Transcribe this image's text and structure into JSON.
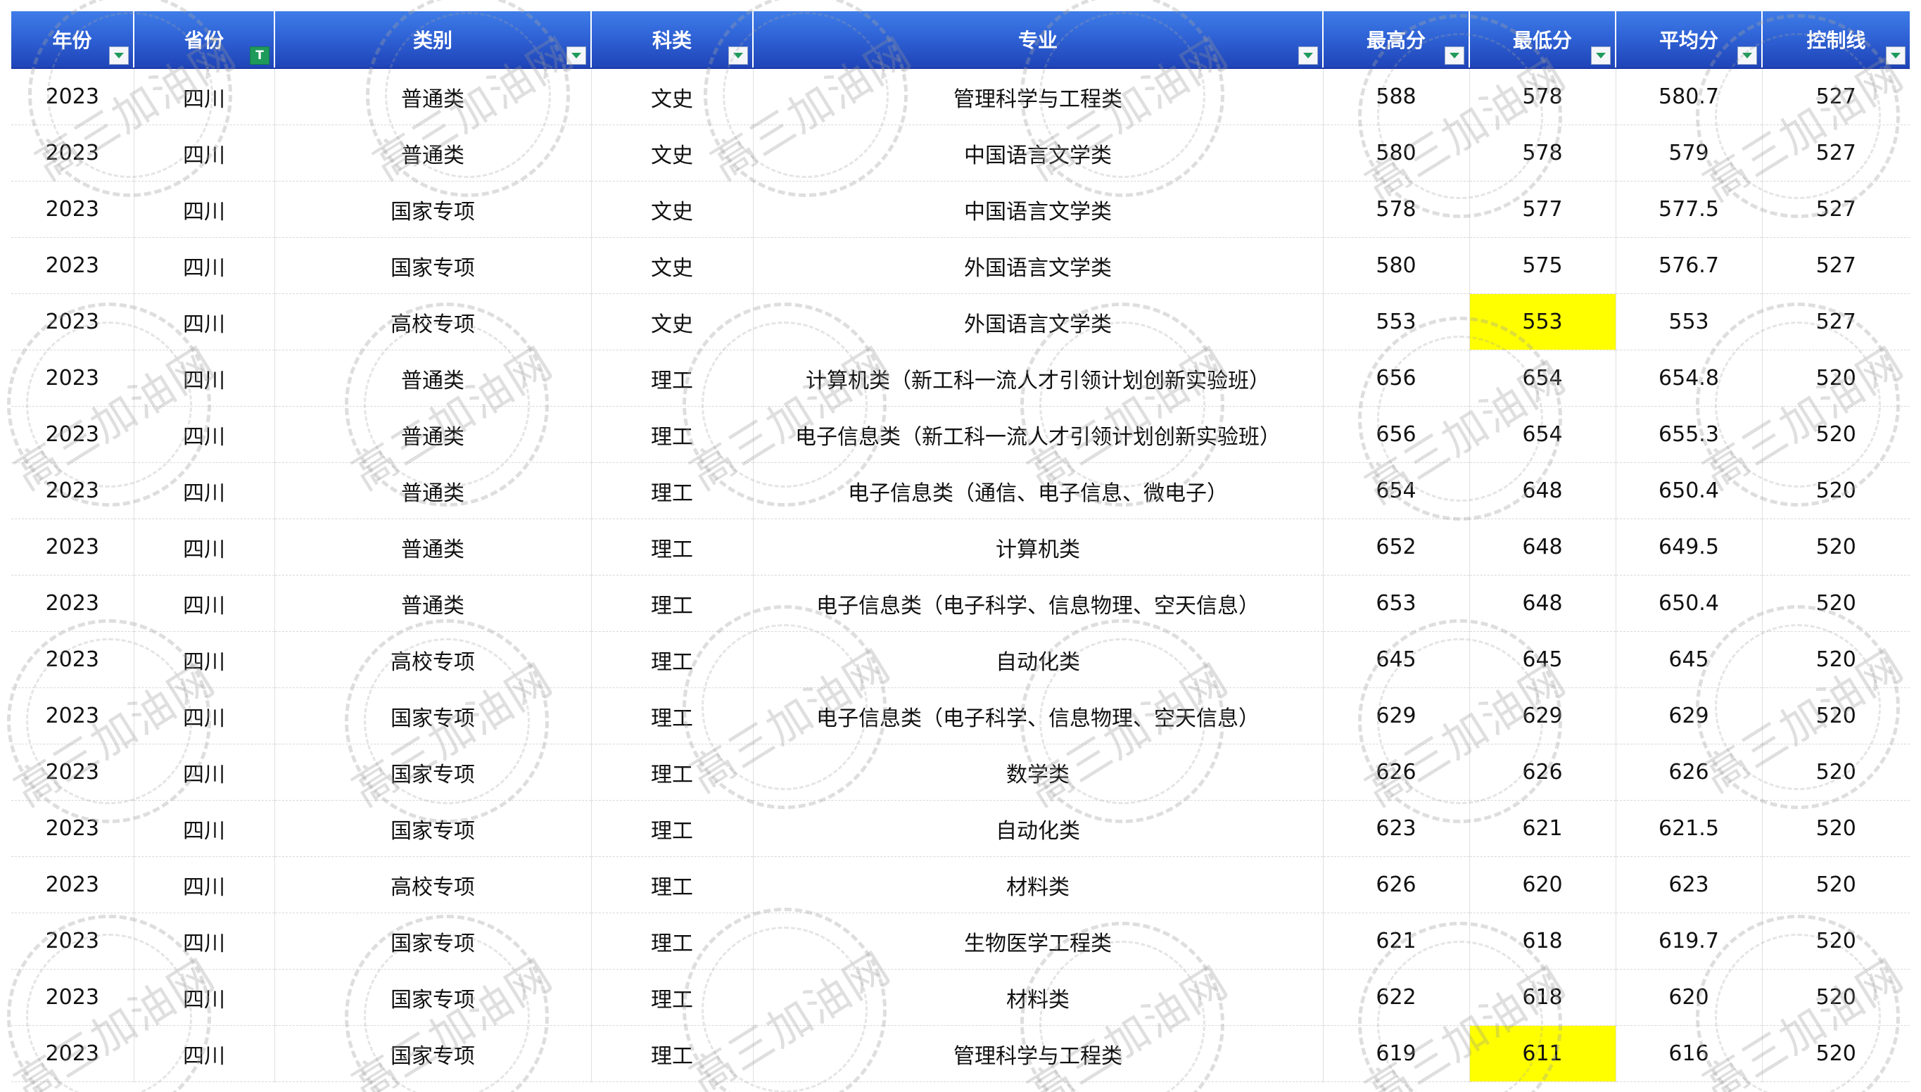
{
  "columns": [
    {
      "label": "年份",
      "filter": "normal"
    },
    {
      "label": "省份",
      "filter": "active"
    },
    {
      "label": "类别",
      "filter": "normal"
    },
    {
      "label": "科类",
      "filter": "normal"
    },
    {
      "label": "专业",
      "filter": "normal"
    },
    {
      "label": "最高分",
      "filter": "normal"
    },
    {
      "label": "最低分",
      "filter": "normal"
    },
    {
      "label": "平均分",
      "filter": "normal"
    },
    {
      "label": "控制线",
      "filter": "normal"
    }
  ],
  "filter_active_glyph": "T",
  "highlight_color": "#ffff00",
  "watermark_text": "高三加油网",
  "rows": [
    {
      "cells": [
        "2023",
        "四川",
        "普通类",
        "文史",
        "管理科学与工程类",
        "588",
        "578",
        "580.7",
        "527"
      ],
      "highlight": null
    },
    {
      "cells": [
        "2023",
        "四川",
        "普通类",
        "文史",
        "中国语言文学类",
        "580",
        "578",
        "579",
        "527"
      ],
      "highlight": null
    },
    {
      "cells": [
        "2023",
        "四川",
        "国家专项",
        "文史",
        "中国语言文学类",
        "578",
        "577",
        "577.5",
        "527"
      ],
      "highlight": null
    },
    {
      "cells": [
        "2023",
        "四川",
        "国家专项",
        "文史",
        "外国语言文学类",
        "580",
        "575",
        "576.7",
        "527"
      ],
      "highlight": null
    },
    {
      "cells": [
        "2023",
        "四川",
        "高校专项",
        "文史",
        "外国语言文学类",
        "553",
        "553",
        "553",
        "527"
      ],
      "highlight": 6
    },
    {
      "cells": [
        "2023",
        "四川",
        "普通类",
        "理工",
        "计算机类（新工科一流人才引领计划创新实验班）",
        "656",
        "654",
        "654.8",
        "520"
      ],
      "highlight": null
    },
    {
      "cells": [
        "2023",
        "四川",
        "普通类",
        "理工",
        "电子信息类（新工科一流人才引领计划创新实验班）",
        "656",
        "654",
        "655.3",
        "520"
      ],
      "highlight": null
    },
    {
      "cells": [
        "2023",
        "四川",
        "普通类",
        "理工",
        "电子信息类（通信、电子信息、微电子）",
        "654",
        "648",
        "650.4",
        "520"
      ],
      "highlight": null
    },
    {
      "cells": [
        "2023",
        "四川",
        "普通类",
        "理工",
        "计算机类",
        "652",
        "648",
        "649.5",
        "520"
      ],
      "highlight": null
    },
    {
      "cells": [
        "2023",
        "四川",
        "普通类",
        "理工",
        "电子信息类（电子科学、信息物理、空天信息）",
        "653",
        "648",
        "650.4",
        "520"
      ],
      "highlight": null
    },
    {
      "cells": [
        "2023",
        "四川",
        "高校专项",
        "理工",
        "自动化类",
        "645",
        "645",
        "645",
        "520"
      ],
      "highlight": null
    },
    {
      "cells": [
        "2023",
        "四川",
        "国家专项",
        "理工",
        "电子信息类（电子科学、信息物理、空天信息）",
        "629",
        "629",
        "629",
        "520"
      ],
      "highlight": null
    },
    {
      "cells": [
        "2023",
        "四川",
        "国家专项",
        "理工",
        "数学类",
        "626",
        "626",
        "626",
        "520"
      ],
      "highlight": null
    },
    {
      "cells": [
        "2023",
        "四川",
        "国家专项",
        "理工",
        "自动化类",
        "623",
        "621",
        "621.5",
        "520"
      ],
      "highlight": null
    },
    {
      "cells": [
        "2023",
        "四川",
        "高校专项",
        "理工",
        "材料类",
        "626",
        "620",
        "623",
        "520"
      ],
      "highlight": null
    },
    {
      "cells": [
        "2023",
        "四川",
        "国家专项",
        "理工",
        "生物医学工程类",
        "621",
        "618",
        "619.7",
        "520"
      ],
      "highlight": null
    },
    {
      "cells": [
        "2023",
        "四川",
        "国家专项",
        "理工",
        "材料类",
        "622",
        "618",
        "620",
        "520"
      ],
      "highlight": null
    },
    {
      "cells": [
        "2023",
        "四川",
        "国家专项",
        "理工",
        "管理科学与工程类",
        "619",
        "611",
        "616",
        "520"
      ],
      "highlight": 6
    }
  ]
}
